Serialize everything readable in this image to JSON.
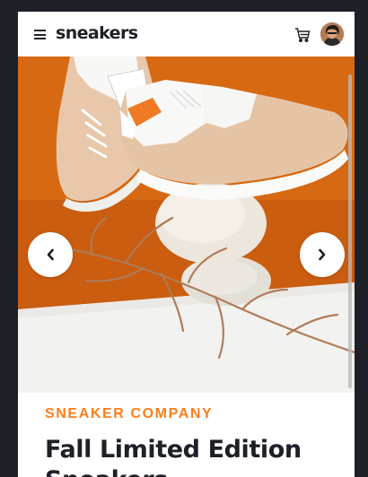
{
  "header": {
    "logo": "sneakers",
    "menu_icon": "hamburger-menu-icon",
    "cart_icon": "cart-icon",
    "avatar": "user-avatar"
  },
  "gallery": {
    "prev_icon": "chevron-left-icon",
    "next_icon": "chevron-right-icon",
    "image": "product-image-sneakers-on-stones"
  },
  "product": {
    "company": "SNEAKER COMPANY",
    "name": "Fall Limited Edition Sneakers"
  },
  "colors": {
    "orange": "#ff7d1a",
    "dark": "#1d2026",
    "page_bg": "#1d2026",
    "white": "#ffffff"
  }
}
